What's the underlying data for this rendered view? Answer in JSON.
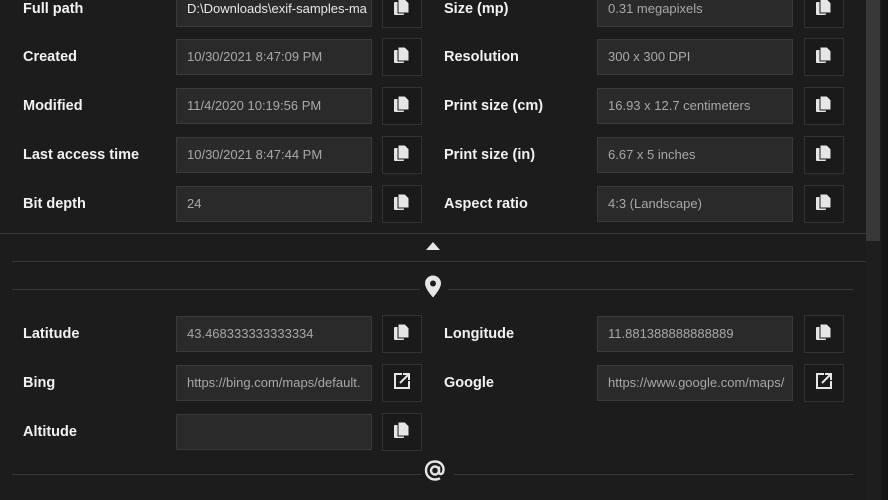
{
  "file_section": {
    "left": [
      {
        "label": "Full path",
        "value": "D:\\Downloads\\exif-samples-ma",
        "action": "copy"
      },
      {
        "label": "Created",
        "value": "10/30/2021 8:47:09 PM",
        "action": "copy"
      },
      {
        "label": "Modified",
        "value": "11/4/2020 10:19:56 PM",
        "action": "copy"
      },
      {
        "label": "Last access time",
        "value": "10/30/2021 8:47:44 PM",
        "action": "copy"
      },
      {
        "label": "Bit depth",
        "value": "24",
        "action": "copy"
      }
    ],
    "right": [
      {
        "label": "Size (mp)",
        "value": "0.31 megapixels",
        "action": "copy"
      },
      {
        "label": "Resolution",
        "value": "300 x 300 DPI",
        "action": "copy"
      },
      {
        "label": "Print size (cm)",
        "value": "16.93 x 12.7 centimeters",
        "action": "copy"
      },
      {
        "label": "Print size (in)",
        "value": "6.67 x 5 inches",
        "action": "copy"
      },
      {
        "label": "Aspect ratio",
        "value": "4:3 (Landscape)",
        "action": "copy"
      }
    ]
  },
  "location_section": {
    "left": [
      {
        "label": "Latitude",
        "value": "43.468333333333334",
        "action": "copy"
      },
      {
        "label": "Bing",
        "value": "https://bing.com/maps/default.",
        "action": "open"
      },
      {
        "label": "Altitude",
        "value": "",
        "action": "copy"
      }
    ],
    "right": [
      {
        "label": "Longitude",
        "value": "11.881388888888889",
        "action": "copy"
      },
      {
        "label": "Google",
        "value": "https://www.google.com/maps/",
        "action": "open"
      }
    ]
  }
}
